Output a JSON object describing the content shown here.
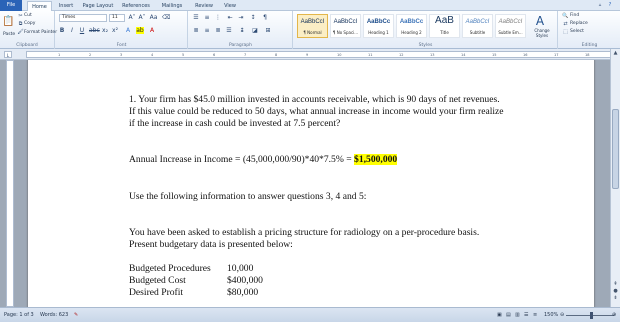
{
  "ribbon": {
    "tabs": [
      "File",
      "Home",
      "Insert",
      "Page Layout",
      "References",
      "Mailings",
      "Review",
      "View"
    ],
    "active_tab": "Home",
    "clipboard": {
      "cut": "Cut",
      "copy": "Copy",
      "paste": "Paste",
      "format_painter": "Format Painter",
      "label": "Clipboard"
    },
    "font": {
      "name": "Times",
      "size": "11",
      "label": "Font"
    },
    "paragraph": {
      "label": "Paragraph"
    },
    "styles": {
      "label": "Styles",
      "items": [
        {
          "preview": "AaBbCcI",
          "name": "¶ Normal"
        },
        {
          "preview": "AaBbCcI",
          "name": "¶ No Spaci..."
        },
        {
          "preview": "AaBbCc",
          "name": "Heading 1"
        },
        {
          "preview": "AaBbCc",
          "name": "Heading 2"
        },
        {
          "preview": "AaB",
          "name": "Title"
        },
        {
          "preview": "AaBbCcI",
          "name": "Subtitle"
        },
        {
          "preview": "AaBbCcI",
          "name": "Subtle Em..."
        }
      ],
      "change_styles": "Change Styles"
    },
    "editing": {
      "find": "Find",
      "replace": "Replace",
      "select": "Select",
      "label": "Editing"
    }
  },
  "document": {
    "q1_lines": [
      "1. Your firm has $45.0 million invested in accounts receivable, which is 90 days of net revenues.",
      "If this value could be reduced to 50 days, what annual increase in income would your firm realize",
      "if the increase in cash could be invested at 7.5 percent?"
    ],
    "answer_prefix": "Annual Increase in Income = (45,000,000/90)*40*7.5% = ",
    "answer_value": "$1,500,000",
    "instruction": "Use the following information to answer questions 3, 4 and 5:",
    "pricing_lines": [
      "You have been asked to establish a pricing structure for radiology on a per-procedure basis.",
      "Present budgetary data is presented below:"
    ],
    "budget": [
      {
        "label": "Budgeted Procedures",
        "value": "10,000"
      },
      {
        "label": "Budgeted Cost",
        "value": "$400,000"
      },
      {
        "label": "Desired Profit",
        "value": "$80,000"
      }
    ]
  },
  "status": {
    "page": "Page: 1 of 3",
    "words": "Words: 623",
    "zoom": "150%"
  },
  "colors": {
    "file_tab": "#2a63b7",
    "highlight": "#ffff00",
    "workspace": "#9ea9b7"
  }
}
